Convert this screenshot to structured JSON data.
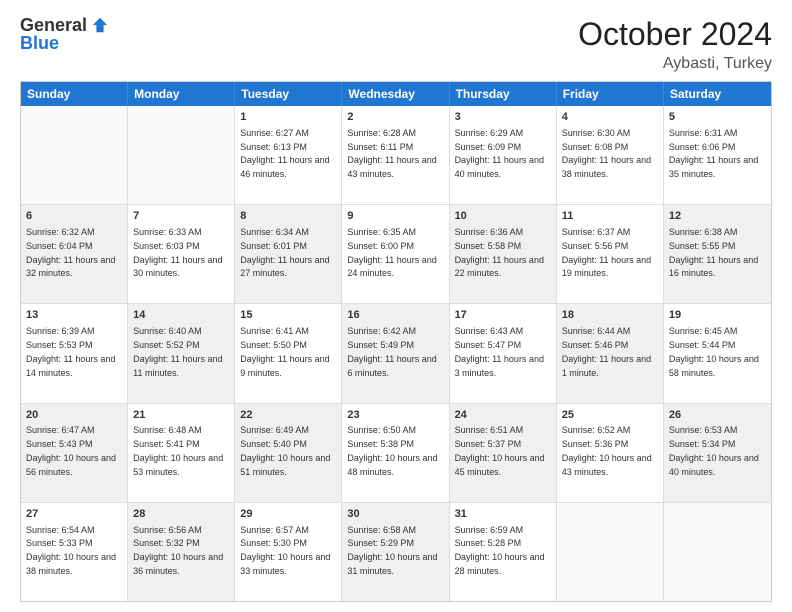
{
  "logo": {
    "general": "General",
    "blue": "Blue"
  },
  "title": "October 2024",
  "location": "Aybasti, Turkey",
  "weekdays": [
    "Sunday",
    "Monday",
    "Tuesday",
    "Wednesday",
    "Thursday",
    "Friday",
    "Saturday"
  ],
  "weeks": [
    [
      {
        "day": "",
        "sunrise": "",
        "sunset": "",
        "daylight": "",
        "shaded": false,
        "empty": true
      },
      {
        "day": "",
        "sunrise": "",
        "sunset": "",
        "daylight": "",
        "shaded": false,
        "empty": true
      },
      {
        "day": "1",
        "sunrise": "Sunrise: 6:27 AM",
        "sunset": "Sunset: 6:13 PM",
        "daylight": "Daylight: 11 hours and 46 minutes.",
        "shaded": false,
        "empty": false
      },
      {
        "day": "2",
        "sunrise": "Sunrise: 6:28 AM",
        "sunset": "Sunset: 6:11 PM",
        "daylight": "Daylight: 11 hours and 43 minutes.",
        "shaded": false,
        "empty": false
      },
      {
        "day": "3",
        "sunrise": "Sunrise: 6:29 AM",
        "sunset": "Sunset: 6:09 PM",
        "daylight": "Daylight: 11 hours and 40 minutes.",
        "shaded": false,
        "empty": false
      },
      {
        "day": "4",
        "sunrise": "Sunrise: 6:30 AM",
        "sunset": "Sunset: 6:08 PM",
        "daylight": "Daylight: 11 hours and 38 minutes.",
        "shaded": false,
        "empty": false
      },
      {
        "day": "5",
        "sunrise": "Sunrise: 6:31 AM",
        "sunset": "Sunset: 6:06 PM",
        "daylight": "Daylight: 11 hours and 35 minutes.",
        "shaded": false,
        "empty": false
      }
    ],
    [
      {
        "day": "6",
        "sunrise": "Sunrise: 6:32 AM",
        "sunset": "Sunset: 6:04 PM",
        "daylight": "Daylight: 11 hours and 32 minutes.",
        "shaded": true,
        "empty": false
      },
      {
        "day": "7",
        "sunrise": "Sunrise: 6:33 AM",
        "sunset": "Sunset: 6:03 PM",
        "daylight": "Daylight: 11 hours and 30 minutes.",
        "shaded": false,
        "empty": false
      },
      {
        "day": "8",
        "sunrise": "Sunrise: 6:34 AM",
        "sunset": "Sunset: 6:01 PM",
        "daylight": "Daylight: 11 hours and 27 minutes.",
        "shaded": true,
        "empty": false
      },
      {
        "day": "9",
        "sunrise": "Sunrise: 6:35 AM",
        "sunset": "Sunset: 6:00 PM",
        "daylight": "Daylight: 11 hours and 24 minutes.",
        "shaded": false,
        "empty": false
      },
      {
        "day": "10",
        "sunrise": "Sunrise: 6:36 AM",
        "sunset": "Sunset: 5:58 PM",
        "daylight": "Daylight: 11 hours and 22 minutes.",
        "shaded": true,
        "empty": false
      },
      {
        "day": "11",
        "sunrise": "Sunrise: 6:37 AM",
        "sunset": "Sunset: 5:56 PM",
        "daylight": "Daylight: 11 hours and 19 minutes.",
        "shaded": false,
        "empty": false
      },
      {
        "day": "12",
        "sunrise": "Sunrise: 6:38 AM",
        "sunset": "Sunset: 5:55 PM",
        "daylight": "Daylight: 11 hours and 16 minutes.",
        "shaded": true,
        "empty": false
      }
    ],
    [
      {
        "day": "13",
        "sunrise": "Sunrise: 6:39 AM",
        "sunset": "Sunset: 5:53 PM",
        "daylight": "Daylight: 11 hours and 14 minutes.",
        "shaded": false,
        "empty": false
      },
      {
        "day": "14",
        "sunrise": "Sunrise: 6:40 AM",
        "sunset": "Sunset: 5:52 PM",
        "daylight": "Daylight: 11 hours and 11 minutes.",
        "shaded": true,
        "empty": false
      },
      {
        "day": "15",
        "sunrise": "Sunrise: 6:41 AM",
        "sunset": "Sunset: 5:50 PM",
        "daylight": "Daylight: 11 hours and 9 minutes.",
        "shaded": false,
        "empty": false
      },
      {
        "day": "16",
        "sunrise": "Sunrise: 6:42 AM",
        "sunset": "Sunset: 5:49 PM",
        "daylight": "Daylight: 11 hours and 6 minutes.",
        "shaded": true,
        "empty": false
      },
      {
        "day": "17",
        "sunrise": "Sunrise: 6:43 AM",
        "sunset": "Sunset: 5:47 PM",
        "daylight": "Daylight: 11 hours and 3 minutes.",
        "shaded": false,
        "empty": false
      },
      {
        "day": "18",
        "sunrise": "Sunrise: 6:44 AM",
        "sunset": "Sunset: 5:46 PM",
        "daylight": "Daylight: 11 hours and 1 minute.",
        "shaded": true,
        "empty": false
      },
      {
        "day": "19",
        "sunrise": "Sunrise: 6:45 AM",
        "sunset": "Sunset: 5:44 PM",
        "daylight": "Daylight: 10 hours and 58 minutes.",
        "shaded": false,
        "empty": false
      }
    ],
    [
      {
        "day": "20",
        "sunrise": "Sunrise: 6:47 AM",
        "sunset": "Sunset: 5:43 PM",
        "daylight": "Daylight: 10 hours and 56 minutes.",
        "shaded": true,
        "empty": false
      },
      {
        "day": "21",
        "sunrise": "Sunrise: 6:48 AM",
        "sunset": "Sunset: 5:41 PM",
        "daylight": "Daylight: 10 hours and 53 minutes.",
        "shaded": false,
        "empty": false
      },
      {
        "day": "22",
        "sunrise": "Sunrise: 6:49 AM",
        "sunset": "Sunset: 5:40 PM",
        "daylight": "Daylight: 10 hours and 51 minutes.",
        "shaded": true,
        "empty": false
      },
      {
        "day": "23",
        "sunrise": "Sunrise: 6:50 AM",
        "sunset": "Sunset: 5:38 PM",
        "daylight": "Daylight: 10 hours and 48 minutes.",
        "shaded": false,
        "empty": false
      },
      {
        "day": "24",
        "sunrise": "Sunrise: 6:51 AM",
        "sunset": "Sunset: 5:37 PM",
        "daylight": "Daylight: 10 hours and 45 minutes.",
        "shaded": true,
        "empty": false
      },
      {
        "day": "25",
        "sunrise": "Sunrise: 6:52 AM",
        "sunset": "Sunset: 5:36 PM",
        "daylight": "Daylight: 10 hours and 43 minutes.",
        "shaded": false,
        "empty": false
      },
      {
        "day": "26",
        "sunrise": "Sunrise: 6:53 AM",
        "sunset": "Sunset: 5:34 PM",
        "daylight": "Daylight: 10 hours and 40 minutes.",
        "shaded": true,
        "empty": false
      }
    ],
    [
      {
        "day": "27",
        "sunrise": "Sunrise: 6:54 AM",
        "sunset": "Sunset: 5:33 PM",
        "daylight": "Daylight: 10 hours and 38 minutes.",
        "shaded": false,
        "empty": false
      },
      {
        "day": "28",
        "sunrise": "Sunrise: 6:56 AM",
        "sunset": "Sunset: 5:32 PM",
        "daylight": "Daylight: 10 hours and 36 minutes.",
        "shaded": true,
        "empty": false
      },
      {
        "day": "29",
        "sunrise": "Sunrise: 6:57 AM",
        "sunset": "Sunset: 5:30 PM",
        "daylight": "Daylight: 10 hours and 33 minutes.",
        "shaded": false,
        "empty": false
      },
      {
        "day": "30",
        "sunrise": "Sunrise: 6:58 AM",
        "sunset": "Sunset: 5:29 PM",
        "daylight": "Daylight: 10 hours and 31 minutes.",
        "shaded": true,
        "empty": false
      },
      {
        "day": "31",
        "sunrise": "Sunrise: 6:59 AM",
        "sunset": "Sunset: 5:28 PM",
        "daylight": "Daylight: 10 hours and 28 minutes.",
        "shaded": false,
        "empty": false
      },
      {
        "day": "",
        "sunrise": "",
        "sunset": "",
        "daylight": "",
        "shaded": true,
        "empty": true
      },
      {
        "day": "",
        "sunrise": "",
        "sunset": "",
        "daylight": "",
        "shaded": true,
        "empty": true
      }
    ]
  ]
}
